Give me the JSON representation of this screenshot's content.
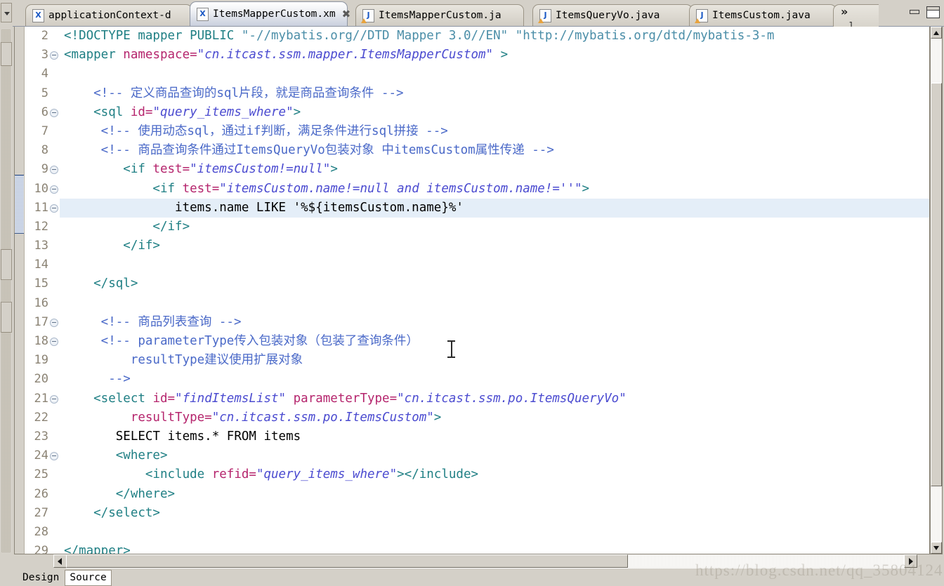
{
  "window": {
    "minimize_label": "Minimize",
    "maximize_label": "Maximize"
  },
  "tabs": {
    "overflow_chevron": "»",
    "overflow_count": "1",
    "items": [
      {
        "label": "applicationContext-d",
        "icon": "xml-file-icon",
        "kind": "xml",
        "active": false,
        "closable": false
      },
      {
        "label": "ItemsMapperCustom.xm",
        "icon": "xml-file-icon",
        "kind": "xml",
        "active": true,
        "closable": true,
        "close_glyph": "✖"
      },
      {
        "label": "ItemsMapperCustom.ja",
        "icon": "java-file-icon",
        "kind": "java",
        "active": false,
        "closable": false
      },
      {
        "label": "ItemsQueryVo.java",
        "icon": "java-file-icon",
        "kind": "java",
        "active": false,
        "closable": false
      },
      {
        "label": "ItemsCustom.java",
        "icon": "java-file-icon",
        "kind": "java",
        "active": false,
        "closable": false
      }
    ]
  },
  "editor": {
    "current_line": 11,
    "change_marker_lines": [
      10,
      11,
      12
    ],
    "first_visible_line": 2,
    "last_visible_line": 29,
    "colors": {
      "tag": "#1f7f84",
      "attribute": "#b5256d",
      "attribute_value": "#4b4bd0",
      "comment": "#4a69c8",
      "text": "#000000",
      "doctype_string": "#4b8ea8",
      "current_line_bg": "#e4eef8",
      "change_bar": "#5f7cb0"
    },
    "lines": [
      {
        "num": 2,
        "fold": false,
        "cur": false,
        "tokens": [
          {
            "c": "t-doctype",
            "t": "<!DOCTYPE mapper PUBLIC "
          },
          {
            "c": "t-dstr",
            "t": "\"-//mybatis.org//DTD Mapper 3.0//EN\" \"http://mybatis.org/dtd/mybatis-3-m"
          }
        ]
      },
      {
        "num": 3,
        "fold": true,
        "cur": false,
        "tokens": [
          {
            "c": "t-tag",
            "t": "<mapper "
          },
          {
            "c": "t-attr",
            "t": "namespace="
          },
          {
            "c": "t-val",
            "t": "\"cn.itcast.ssm.mapper.ItemsMapperCustom\""
          },
          {
            "c": "t-tag",
            "t": " >"
          }
        ]
      },
      {
        "num": 4,
        "fold": false,
        "cur": false,
        "tokens": []
      },
      {
        "num": 5,
        "fold": false,
        "cur": false,
        "tokens": [
          {
            "c": "t-cmt",
            "t": "    <!-- 定义商品查询的sql片段，就是商品查询条件 -->"
          }
        ]
      },
      {
        "num": 6,
        "fold": true,
        "cur": false,
        "tokens": [
          {
            "c": "t-tag",
            "t": "    <sql "
          },
          {
            "c": "t-attr",
            "t": "id="
          },
          {
            "c": "t-val",
            "t": "\"query_items_where\""
          },
          {
            "c": "t-tag",
            "t": ">"
          }
        ]
      },
      {
        "num": 7,
        "fold": false,
        "cur": false,
        "tokens": [
          {
            "c": "t-cmt",
            "t": "     <!-- 使用动态sql，通过if判断，满足条件进行sql拼接 -->"
          }
        ]
      },
      {
        "num": 8,
        "fold": false,
        "cur": false,
        "tokens": [
          {
            "c": "t-cmt",
            "t": "     <!-- 商品查询条件通过ItemsQueryVo包装对象 中itemsCustom属性传递 -->"
          }
        ]
      },
      {
        "num": 9,
        "fold": true,
        "cur": false,
        "tokens": [
          {
            "c": "t-tag",
            "t": "        <if "
          },
          {
            "c": "t-attr",
            "t": "test="
          },
          {
            "c": "t-val",
            "t": "\"itemsCustom!=null\""
          },
          {
            "c": "t-tag",
            "t": ">"
          }
        ]
      },
      {
        "num": 10,
        "fold": true,
        "cur": false,
        "tokens": [
          {
            "c": "t-tag",
            "t": "            <if "
          },
          {
            "c": "t-attr",
            "t": "test="
          },
          {
            "c": "t-val",
            "t": "\"itemsCustom.name!=null and itemsCustom.name!=''\""
          },
          {
            "c": "t-tag",
            "t": ">"
          }
        ]
      },
      {
        "num": 11,
        "fold": true,
        "cur": true,
        "tokens": [
          {
            "c": "t-txt",
            "t": "               items.name LIKE '%${itemsCustom.name}%'"
          }
        ]
      },
      {
        "num": 12,
        "fold": false,
        "cur": false,
        "tokens": [
          {
            "c": "t-tag",
            "t": "            </if>"
          }
        ]
      },
      {
        "num": 13,
        "fold": false,
        "cur": false,
        "tokens": [
          {
            "c": "t-tag",
            "t": "        </if>"
          }
        ]
      },
      {
        "num": 14,
        "fold": false,
        "cur": false,
        "tokens": []
      },
      {
        "num": 15,
        "fold": false,
        "cur": false,
        "tokens": [
          {
            "c": "t-tag",
            "t": "    </sql>"
          }
        ]
      },
      {
        "num": 16,
        "fold": false,
        "cur": false,
        "tokens": []
      },
      {
        "num": 17,
        "fold": true,
        "cur": false,
        "tokens": [
          {
            "c": "t-cmt",
            "t": "     <!-- 商品列表查询 -->"
          }
        ]
      },
      {
        "num": 18,
        "fold": true,
        "cur": false,
        "tokens": [
          {
            "c": "t-cmt",
            "t": "     <!-- parameterType传入包装对象（包装了查询条件）"
          }
        ]
      },
      {
        "num": 19,
        "fold": false,
        "cur": false,
        "tokens": [
          {
            "c": "t-cmt",
            "t": "         resultType建议使用扩展对象"
          }
        ]
      },
      {
        "num": 20,
        "fold": false,
        "cur": false,
        "tokens": [
          {
            "c": "t-cmt",
            "t": "      -->"
          }
        ]
      },
      {
        "num": 21,
        "fold": true,
        "cur": false,
        "tokens": [
          {
            "c": "t-tag",
            "t": "    <select "
          },
          {
            "c": "t-attr",
            "t": "id="
          },
          {
            "c": "t-val",
            "t": "\"findItemsList\""
          },
          {
            "c": "t-attr",
            "t": " parameterType="
          },
          {
            "c": "t-val",
            "t": "\"cn.itcast.ssm.po.ItemsQueryVo\""
          }
        ]
      },
      {
        "num": 22,
        "fold": false,
        "cur": false,
        "tokens": [
          {
            "c": "t-attr",
            "t": "         resultType="
          },
          {
            "c": "t-val",
            "t": "\"cn.itcast.ssm.po.ItemsCustom\""
          },
          {
            "c": "t-tag",
            "t": ">"
          }
        ]
      },
      {
        "num": 23,
        "fold": false,
        "cur": false,
        "tokens": [
          {
            "c": "t-txt",
            "t": "       SELECT items.* FROM items"
          }
        ]
      },
      {
        "num": 24,
        "fold": true,
        "cur": false,
        "tokens": [
          {
            "c": "t-tag",
            "t": "       <where>"
          }
        ]
      },
      {
        "num": 25,
        "fold": false,
        "cur": false,
        "tokens": [
          {
            "c": "t-tag",
            "t": "           <include "
          },
          {
            "c": "t-attr",
            "t": "refid="
          },
          {
            "c": "t-val",
            "t": "\"query_items_where\""
          },
          {
            "c": "t-tag",
            "t": "></include>"
          }
        ]
      },
      {
        "num": 26,
        "fold": false,
        "cur": false,
        "tokens": [
          {
            "c": "t-tag",
            "t": "       </where>"
          }
        ]
      },
      {
        "num": 27,
        "fold": false,
        "cur": false,
        "tokens": [
          {
            "c": "t-tag",
            "t": "    </select>"
          }
        ]
      },
      {
        "num": 28,
        "fold": false,
        "cur": false,
        "tokens": []
      },
      {
        "num": 29,
        "fold": false,
        "cur": false,
        "tokens": [
          {
            "c": "t-tag",
            "t": "</mapper>"
          }
        ]
      }
    ]
  },
  "scrollbars": {
    "vertical": {
      "up_arrow": "▲",
      "down_arrow": "▼"
    },
    "horizontal": {
      "left_arrow": "◀",
      "right_arrow": "▶"
    }
  },
  "bottom_tabs": {
    "items": [
      {
        "label": "Design",
        "selected": false
      },
      {
        "label": "Source",
        "selected": true
      }
    ]
  },
  "watermark": {
    "text": "https://blog.csdn.net/qq_35804124"
  }
}
